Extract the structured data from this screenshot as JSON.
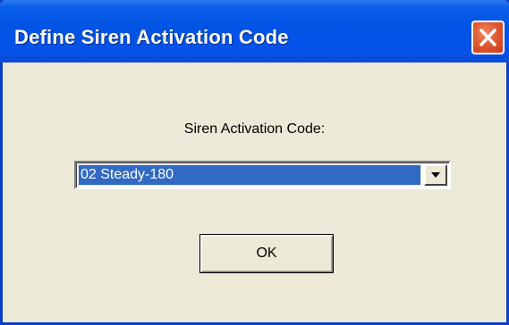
{
  "window": {
    "title": "Define Siren Activation Code"
  },
  "dialog": {
    "field_label": "Siren Activation Code:",
    "combo": {
      "selected_value": "02 Steady-180"
    },
    "ok_label": "OK"
  },
  "icons": {
    "close": "close-icon",
    "dropdown": "chevron-down-icon"
  },
  "colors": {
    "titlebar": "#0054e3",
    "client_background": "#ece9d8",
    "selection": "#316ac5",
    "close_button": "#e05a32"
  }
}
